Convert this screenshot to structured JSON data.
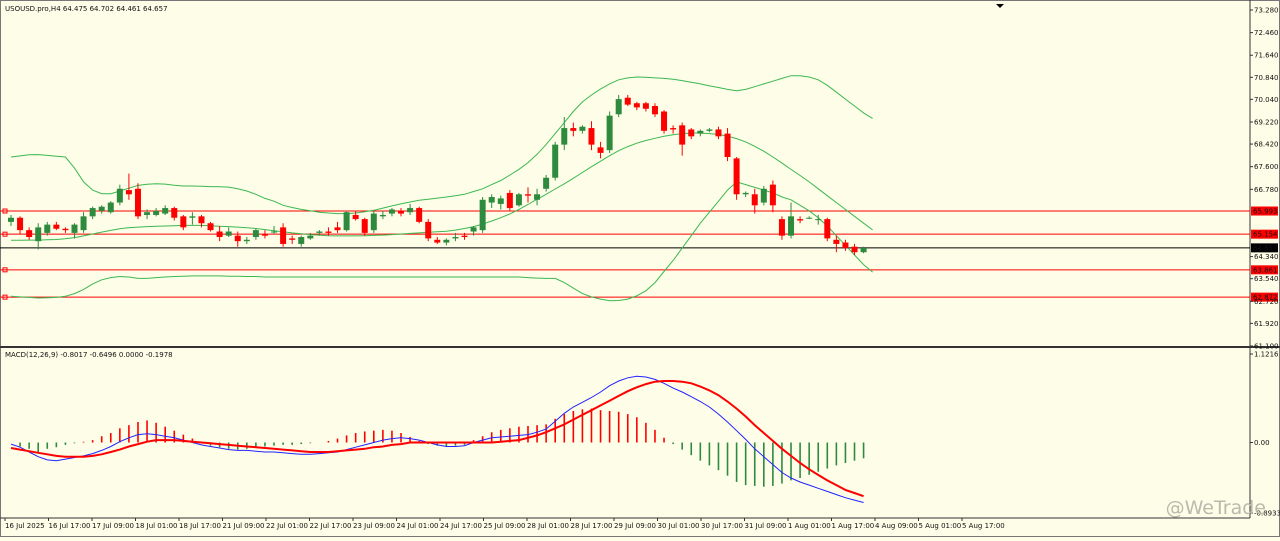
{
  "chart_data": [
    {
      "type": "candlestick",
      "header": "USOUSD.pro,H4  64.475 64.702 64.461 64.657",
      "y_ticks": [
        "73.280",
        "72.460",
        "71.640",
        "70.840",
        "70.040",
        "69.220",
        "68.420",
        "67.600",
        "66.780",
        "65.993",
        "65.154",
        "64.657",
        "64.340",
        "63.861",
        "63.540",
        "62.872",
        "62.720",
        "61.920",
        "61.100"
      ],
      "ylim": [
        61.1,
        73.3
      ],
      "current_price": "64.657",
      "horizontal_levels": [
        {
          "value": 65.993,
          "label": "65.993"
        },
        {
          "value": 65.154,
          "label": "65.154"
        },
        {
          "value": 63.861,
          "label": "63.861"
        },
        {
          "value": 62.872,
          "label": "62.872"
        }
      ],
      "candles": [
        [
          65.6,
          65.85,
          65.45,
          65.75
        ],
        [
          65.75,
          65.8,
          65.15,
          65.3
        ],
        [
          65.3,
          65.4,
          64.95,
          65.05
        ],
        [
          64.9,
          65.55,
          64.6,
          65.4
        ],
        [
          65.2,
          65.6,
          65.1,
          65.5
        ],
        [
          65.5,
          65.6,
          65.3,
          65.35
        ],
        [
          65.35,
          65.4,
          65.2,
          65.3
        ],
        [
          65.2,
          65.55,
          65.0,
          65.5
        ],
        [
          65.3,
          65.95,
          65.2,
          65.8
        ],
        [
          65.8,
          66.15,
          65.7,
          66.1
        ],
        [
          66.0,
          66.2,
          65.9,
          66.15
        ],
        [
          65.95,
          66.35,
          65.9,
          66.3
        ],
        [
          66.3,
          66.95,
          66.2,
          66.8
        ],
        [
          66.75,
          67.35,
          66.4,
          66.6
        ],
        [
          66.8,
          67.0,
          65.7,
          65.8
        ],
        [
          65.85,
          66.05,
          65.7,
          65.95
        ],
        [
          65.85,
          66.1,
          65.8,
          66.0
        ],
        [
          65.9,
          66.2,
          65.85,
          66.1
        ],
        [
          66.1,
          66.15,
          65.65,
          65.75
        ],
        [
          65.8,
          65.85,
          65.3,
          65.4
        ],
        [
          65.75,
          65.95,
          65.5,
          65.8
        ],
        [
          65.8,
          65.85,
          65.4,
          65.55
        ],
        [
          65.55,
          65.6,
          65.25,
          65.3
        ],
        [
          65.25,
          65.45,
          64.9,
          65.05
        ],
        [
          65.1,
          65.4,
          65.05,
          65.25
        ],
        [
          65.1,
          65.25,
          64.7,
          64.9
        ],
        [
          64.9,
          65.05,
          64.8,
          64.95
        ],
        [
          65.05,
          65.35,
          64.95,
          65.3
        ],
        [
          65.15,
          65.3,
          65.0,
          65.1
        ],
        [
          65.25,
          65.45,
          65.15,
          65.25
        ],
        [
          65.4,
          65.55,
          64.7,
          64.8
        ],
        [
          65.0,
          65.1,
          64.8,
          64.95
        ],
        [
          64.8,
          65.1,
          64.7,
          65.05
        ],
        [
          65.0,
          65.2,
          64.95,
          65.1
        ],
        [
          65.2,
          65.3,
          65.1,
          65.25
        ],
        [
          65.25,
          65.4,
          65.1,
          65.2
        ],
        [
          65.4,
          65.6,
          65.2,
          65.3
        ],
        [
          65.3,
          66.0,
          65.25,
          65.95
        ],
        [
          65.85,
          66.0,
          65.65,
          65.7
        ],
        [
          65.7,
          65.75,
          65.1,
          65.2
        ],
        [
          65.3,
          66.0,
          65.2,
          65.9
        ],
        [
          65.8,
          66.0,
          65.7,
          65.85
        ],
        [
          65.9,
          66.1,
          65.8,
          66.05
        ],
        [
          66.0,
          66.1,
          65.8,
          65.9
        ],
        [
          65.95,
          66.25,
          65.85,
          66.1
        ],
        [
          66.1,
          66.15,
          65.55,
          65.6
        ],
        [
          65.6,
          65.7,
          64.9,
          65.0
        ],
        [
          64.95,
          65.05,
          64.8,
          64.85
        ],
        [
          64.85,
          65.0,
          64.75,
          64.95
        ],
        [
          65.0,
          65.2,
          64.9,
          65.05
        ],
        [
          65.1,
          65.2,
          64.95,
          65.05
        ],
        [
          65.25,
          65.45,
          65.1,
          65.4
        ],
        [
          65.3,
          66.5,
          65.2,
          66.4
        ],
        [
          66.3,
          66.6,
          66.1,
          66.5
        ],
        [
          66.25,
          66.55,
          66.05,
          66.45
        ],
        [
          66.65,
          66.75,
          66.0,
          66.1
        ],
        [
          66.2,
          66.65,
          66.15,
          66.6
        ],
        [
          66.6,
          66.85,
          66.3,
          66.55
        ],
        [
          66.4,
          66.8,
          66.2,
          66.6
        ],
        [
          66.8,
          67.3,
          66.7,
          67.2
        ],
        [
          67.2,
          68.5,
          67.1,
          68.4
        ],
        [
          68.4,
          69.4,
          68.2,
          69.0
        ],
        [
          69.0,
          69.2,
          68.7,
          68.9
        ],
        [
          68.9,
          69.1,
          68.8,
          69.05
        ],
        [
          69.0,
          69.25,
          68.2,
          68.4
        ],
        [
          68.3,
          68.5,
          67.9,
          68.1
        ],
        [
          68.2,
          69.6,
          68.1,
          69.45
        ],
        [
          69.5,
          70.2,
          69.4,
          70.05
        ],
        [
          70.1,
          70.2,
          69.8,
          69.85
        ],
        [
          69.9,
          69.95,
          69.65,
          69.75
        ],
        [
          69.9,
          69.95,
          69.6,
          69.7
        ],
        [
          69.8,
          69.9,
          69.4,
          69.5
        ],
        [
          69.6,
          69.65,
          68.8,
          68.9
        ],
        [
          69.0,
          69.1,
          68.8,
          68.95
        ],
        [
          69.1,
          69.2,
          68.0,
          68.4
        ],
        [
          68.95,
          69.0,
          68.6,
          68.7
        ],
        [
          68.8,
          68.95,
          68.7,
          68.9
        ],
        [
          68.9,
          69.0,
          68.85,
          68.95
        ],
        [
          68.95,
          69.05,
          68.6,
          68.7
        ],
        [
          68.8,
          69.0,
          67.8,
          67.95
        ],
        [
          67.9,
          67.95,
          66.4,
          66.6
        ],
        [
          66.6,
          66.7,
          66.5,
          66.65
        ],
        [
          66.6,
          66.8,
          65.9,
          66.2
        ],
        [
          66.3,
          66.9,
          66.2,
          66.8
        ],
        [
          66.95,
          67.1,
          65.95,
          66.2
        ],
        [
          65.7,
          65.8,
          64.95,
          65.1
        ],
        [
          65.1,
          66.3,
          65.0,
          65.8
        ],
        [
          65.7,
          65.8,
          65.55,
          65.65
        ],
        [
          65.75,
          65.8,
          65.7,
          65.75
        ],
        [
          65.7,
          65.85,
          65.5,
          65.7
        ],
        [
          65.7,
          65.75,
          64.9,
          65.0
        ],
        [
          64.95,
          65.1,
          64.5,
          64.8
        ],
        [
          64.85,
          64.95,
          64.55,
          64.65
        ],
        [
          64.7,
          64.8,
          64.4,
          64.5
        ],
        [
          64.5,
          64.7,
          64.46,
          64.65
        ]
      ],
      "bollinger_upper": [
        67.95,
        67.99,
        68.03,
        68.04,
        68.01,
        67.98,
        67.95,
        67.55,
        67.05,
        66.75,
        66.62,
        66.62,
        66.72,
        66.82,
        66.92,
        66.96,
        66.98,
        66.97,
        66.93,
        66.9,
        66.9,
        66.89,
        66.88,
        66.87,
        66.86,
        66.8,
        66.72,
        66.6,
        66.45,
        66.35,
        66.2,
        66.12,
        66.05,
        66.0,
        65.95,
        65.92,
        65.9,
        65.9,
        65.92,
        65.97,
        66.02,
        66.1,
        66.18,
        66.25,
        66.32,
        66.38,
        66.42,
        66.46,
        66.5,
        66.55,
        66.6,
        66.7,
        66.8,
        66.95,
        67.1,
        67.3,
        67.5,
        67.75,
        68.05,
        68.4,
        68.8,
        69.2,
        69.6,
        69.95,
        70.2,
        70.42,
        70.6,
        70.75,
        70.82,
        70.85,
        70.84,
        70.82,
        70.8,
        70.77,
        70.72,
        70.66,
        70.6,
        70.53,
        70.47,
        70.4,
        70.35,
        70.4,
        70.5,
        70.6,
        70.7,
        70.8,
        70.9,
        70.9,
        70.85,
        70.75,
        70.55,
        70.3,
        70.05,
        69.8,
        69.55,
        69.35
      ],
      "bollinger_middle": [
        64.93,
        64.93,
        64.94,
        64.94,
        64.95,
        64.96,
        64.99,
        65.03,
        65.09,
        65.16,
        65.23,
        65.29,
        65.35,
        65.39,
        65.41,
        65.43,
        65.44,
        65.45,
        65.46,
        65.47,
        65.47,
        65.47,
        65.46,
        65.44,
        65.43,
        65.41,
        65.39,
        65.36,
        65.32,
        65.28,
        65.24,
        65.2,
        65.17,
        65.14,
        65.12,
        65.1,
        65.09,
        65.09,
        65.09,
        65.1,
        65.11,
        65.12,
        65.14,
        65.16,
        65.18,
        65.2,
        65.22,
        65.24,
        65.26,
        65.3,
        65.36,
        65.43,
        65.52,
        65.63,
        65.75,
        65.89,
        66.05,
        66.23,
        66.42,
        66.6,
        66.79,
        66.98,
        67.18,
        67.39,
        67.6,
        67.8,
        68.0,
        68.18,
        68.33,
        68.45,
        68.55,
        68.63,
        68.7,
        68.76,
        68.8,
        68.82,
        68.82,
        68.8,
        68.77,
        68.71,
        68.62,
        68.5,
        68.34,
        68.16,
        67.95,
        67.73,
        67.5,
        67.28,
        67.05,
        66.8,
        66.55,
        66.3,
        66.05,
        65.8,
        65.55,
        65.31
      ],
      "bollinger_lower": [
        62.9,
        62.88,
        62.86,
        62.84,
        62.85,
        62.86,
        62.9,
        63.0,
        63.15,
        63.35,
        63.5,
        63.58,
        63.62,
        63.6,
        63.55,
        63.55,
        63.58,
        63.6,
        63.62,
        63.63,
        63.64,
        63.64,
        63.64,
        63.64,
        63.63,
        63.63,
        63.62,
        63.62,
        63.6,
        63.6,
        63.6,
        63.6,
        63.6,
        63.6,
        63.6,
        63.6,
        63.6,
        63.6,
        63.6,
        63.6,
        63.6,
        63.6,
        63.6,
        63.6,
        63.6,
        63.6,
        63.6,
        63.6,
        63.6,
        63.6,
        63.6,
        63.6,
        63.6,
        63.6,
        63.6,
        63.6,
        63.6,
        63.58,
        63.56,
        63.55,
        63.55,
        63.4,
        63.2,
        63.0,
        62.88,
        62.8,
        62.74,
        62.75,
        62.8,
        62.92,
        63.1,
        63.4,
        63.8,
        64.2,
        64.65,
        65.1,
        65.55,
        65.95,
        66.35,
        66.75,
        67.05,
        66.95,
        66.85,
        66.75,
        66.65,
        66.5,
        66.4,
        66.2,
        66.0,
        65.75,
        65.45,
        65.1,
        64.75,
        64.4,
        64.05,
        63.78
      ]
    },
    {
      "type": "macd",
      "header": "MACD(12,26,9) -0.8017 -0.6496 0.0000 -0.1978",
      "y_ticks": [
        "1.1216",
        "0.00",
        "-0.8933"
      ],
      "ylim": [
        -0.8933,
        1.1216
      ],
      "histogram": [
        0,
        -0.05,
        -0.08,
        -0.12,
        -0.08,
        -0.06,
        -0.03,
        -0.01,
        0.01,
        0.03,
        0.08,
        0.12,
        0.18,
        0.22,
        0.26,
        0.28,
        0.25,
        0.2,
        0.15,
        0.1,
        0.05,
        -0.01,
        -0.04,
        -0.06,
        -0.08,
        -0.09,
        -0.08,
        -0.06,
        -0.05,
        -0.04,
        -0.03,
        -0.03,
        -0.02,
        -0.01,
        0,
        0.02,
        0.05,
        0.09,
        0.12,
        0.14,
        0.15,
        0.16,
        0.15,
        0.12,
        0.07,
        0.02,
        -0.02,
        -0.04,
        -0.05,
        -0.04,
        -0.03,
        0.03,
        0.08,
        0.13,
        0.16,
        0.18,
        0.2,
        0.21,
        0.22,
        0.23,
        0.3,
        0.36,
        0.4,
        0.42,
        0.43,
        0.41,
        0.4,
        0.39,
        0.36,
        0.32,
        0.25,
        0.16,
        0.06,
        -0.02,
        -0.09,
        -0.16,
        -0.23,
        -0.29,
        -0.35,
        -0.42,
        -0.5,
        -0.54,
        -0.55,
        -0.56,
        -0.55,
        -0.52,
        -0.48,
        -0.45,
        -0.41,
        -0.37,
        -0.33,
        -0.29,
        -0.26,
        -0.23,
        -0.2
      ],
      "macd_line": [
        -0.02,
        -0.06,
        -0.12,
        -0.18,
        -0.22,
        -0.23,
        -0.21,
        -0.19,
        -0.17,
        -0.14,
        -0.1,
        -0.05,
        0.01,
        0.06,
        0.1,
        0.11,
        0.1,
        0.08,
        0.06,
        0.03,
        0.0,
        -0.03,
        -0.05,
        -0.07,
        -0.09,
        -0.1,
        -0.1,
        -0.11,
        -0.12,
        -0.12,
        -0.13,
        -0.14,
        -0.15,
        -0.15,
        -0.14,
        -0.13,
        -0.12,
        -0.09,
        -0.06,
        -0.03,
        0.0,
        0.03,
        0.05,
        0.06,
        0.05,
        0.03,
        0.0,
        -0.03,
        -0.05,
        -0.05,
        -0.04,
        0.0,
        0.03,
        0.06,
        0.07,
        0.08,
        0.09,
        0.1,
        0.13,
        0.17,
        0.27,
        0.37,
        0.45,
        0.51,
        0.57,
        0.64,
        0.72,
        0.78,
        0.82,
        0.84,
        0.83,
        0.8,
        0.75,
        0.69,
        0.64,
        0.58,
        0.52,
        0.45,
        0.36,
        0.26,
        0.15,
        0.04,
        -0.08,
        -0.18,
        -0.28,
        -0.38,
        -0.45,
        -0.5,
        -0.54,
        -0.58,
        -0.62,
        -0.66,
        -0.7,
        -0.73,
        -0.76
      ],
      "signal_line": [
        -0.07,
        -0.09,
        -0.11,
        -0.13,
        -0.15,
        -0.17,
        -0.18,
        -0.18,
        -0.18,
        -0.17,
        -0.15,
        -0.12,
        -0.09,
        -0.05,
        -0.02,
        0.01,
        0.03,
        0.03,
        0.03,
        0.02,
        0.01,
        0.0,
        -0.01,
        -0.02,
        -0.03,
        -0.04,
        -0.05,
        -0.06,
        -0.07,
        -0.08,
        -0.09,
        -0.1,
        -0.11,
        -0.12,
        -0.12,
        -0.12,
        -0.11,
        -0.1,
        -0.09,
        -0.08,
        -0.06,
        -0.05,
        -0.03,
        -0.02,
        0.0,
        0.0,
        0.0,
        0.0,
        0.0,
        0.0,
        0.0,
        0.0,
        0.0,
        0.0,
        0.01,
        0.02,
        0.03,
        0.06,
        0.09,
        0.13,
        0.18,
        0.23,
        0.29,
        0.35,
        0.41,
        0.47,
        0.53,
        0.59,
        0.65,
        0.7,
        0.74,
        0.77,
        0.78,
        0.78,
        0.77,
        0.75,
        0.71,
        0.66,
        0.6,
        0.52,
        0.43,
        0.33,
        0.22,
        0.12,
        0.02,
        -0.08,
        -0.17,
        -0.26,
        -0.34,
        -0.41,
        -0.48,
        -0.54,
        -0.6,
        -0.64,
        -0.68
      ]
    }
  ],
  "time_axis": {
    "labels": [
      "16 Jul 2025",
      "16 Jul 17:00",
      "17 Jul 09:00",
      "18 Jul 01:00",
      "18 Jul 17:00",
      "21 Jul 09:00",
      "22 Jul 01:00",
      "22 Jul 17:00",
      "23 Jul 09:00",
      "24 Jul 01:00",
      "24 Jul 17:00",
      "25 Jul 09:00",
      "28 Jul 01:00",
      "28 Jul 17:00",
      "29 Jul 09:00",
      "30 Jul 01:00",
      "30 Jul 17:00",
      "31 Jul 09:00",
      "1 Aug 01:00",
      "1 Aug 17:00",
      "4 Aug 09:00",
      "5 Aug 01:00",
      "5 Aug 17:00"
    ]
  },
  "watermark": "@WeTrade",
  "colors": {
    "background": "#fdfde8",
    "bull": "#2e8b3e",
    "bear": "#ff0000",
    "bands": "#3cb850",
    "macd_line": "#2222ff",
    "signal_line": "#ff0000",
    "levels": "#ff0000"
  }
}
